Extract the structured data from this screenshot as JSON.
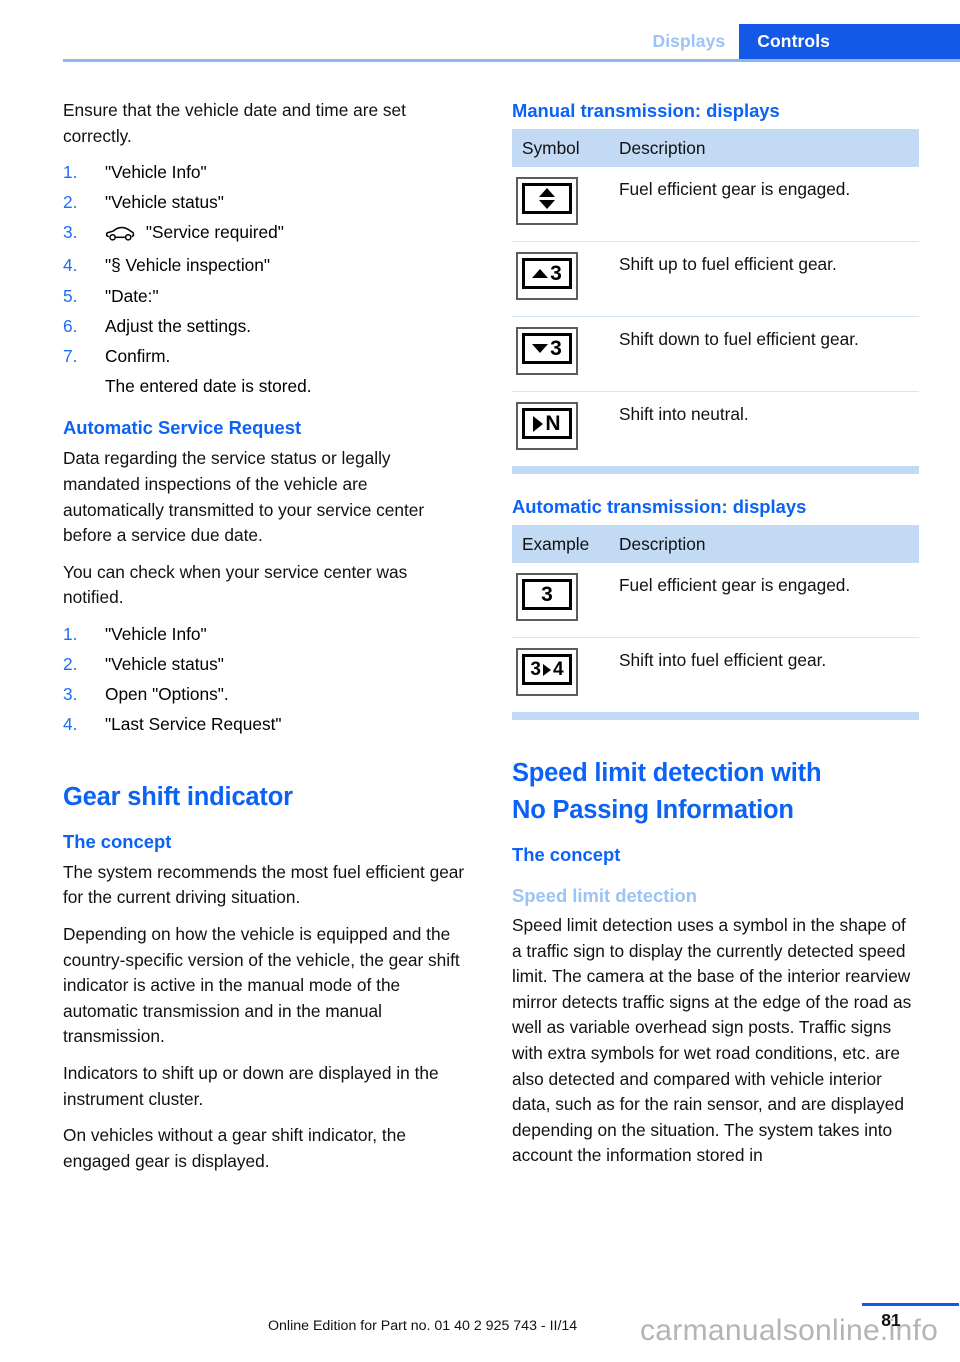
{
  "header": {
    "tab_inactive": "Displays",
    "tab_active": "Controls",
    "accent_blue": "#1458e8",
    "light_blue": "#9cc3f5"
  },
  "left_column": {
    "intro": "Ensure that the vehicle date and time are set correctly.",
    "steps_1": [
      {
        "num": "1.",
        "text": "\"Vehicle Info\""
      },
      {
        "num": "2.",
        "text": "\"Vehicle status\""
      },
      {
        "num": "3.",
        "text": "\"Service required\"",
        "icon": "car-icon"
      },
      {
        "num": "4.",
        "text": "\"§ Vehicle inspection\""
      },
      {
        "num": "5.",
        "text": "\"Date:\""
      },
      {
        "num": "6.",
        "text": "Adjust the settings."
      },
      {
        "num": "7.",
        "text": "Confirm."
      }
    ],
    "step_note": "The entered date is stored.",
    "asr_heading": "Automatic Service Request",
    "asr_p1": "Data regarding the service status or legally mandated inspections of the vehicle are automatically transmitted to your service center before a service due date.",
    "asr_p2": "You can check when your service center was notified.",
    "steps_2": [
      {
        "num": "1.",
        "text": "\"Vehicle Info\""
      },
      {
        "num": "2.",
        "text": "\"Vehicle status\""
      },
      {
        "num": "3.",
        "text": "Open \"Options\"."
      },
      {
        "num": "4.",
        "text": "\"Last Service Request\""
      }
    ],
    "gsi_title": "Gear shift indicator",
    "gsi_concept_heading": "The concept",
    "gsi_p1": "The system recommends the most fuel efficient gear for the current driving situation.",
    "gsi_p2": "Depending on how the vehicle is equipped and the country-specific version of the vehicle, the gear shift indicator is active in the manual mode of the automatic transmission and in the manual transmission.",
    "gsi_p3": "Indicators to shift up or down are displayed in the instrument cluster.",
    "gsi_p4": "On vehicles without a gear shift indicator, the engaged gear is displayed."
  },
  "right_column": {
    "manual_heading": "Manual transmission: displays",
    "manual_table": {
      "headers": [
        "Symbol",
        "Description"
      ],
      "rows": [
        {
          "symbol": "up-down-arrow-display-icon",
          "description": "Fuel efficient gear is engaged."
        },
        {
          "symbol": "shift-up-3-display-icon",
          "gear": "3",
          "description": "Shift up to fuel efficient gear."
        },
        {
          "symbol": "shift-down-3-display-icon",
          "gear": "3",
          "description": "Shift down to fuel efficient gear."
        },
        {
          "symbol": "shift-neutral-display-icon",
          "gear": "N",
          "description": "Shift into neutral."
        }
      ]
    },
    "automatic_heading": "Automatic transmission: displays",
    "automatic_table": {
      "headers": [
        "Example",
        "Description"
      ],
      "rows": [
        {
          "symbol": "gear-3-display-icon",
          "gear": "3",
          "description": "Fuel efficient gear is engaged."
        },
        {
          "symbol": "gear-3-to-4-display-icon",
          "gear_from": "3",
          "gear_to": "4",
          "description": "Shift into fuel efficient gear."
        }
      ]
    },
    "sld_title_line1": "Speed limit detection with",
    "sld_title_line2": "No Passing Information",
    "sld_concept_heading": "The concept",
    "sld_sub_heading": "Speed limit detection",
    "sld_p1": "Speed limit detection uses a symbol in the shape of a traffic sign to display the currently detected speed limit. The camera at the base of the interior rearview mirror detects traffic signs at the edge of the road as well as variable overhead sign posts. Traffic signs with extra symbols for wet road conditions, etc. are also detected and compared with vehicle interior data, such as for the rain sensor, and are displayed depending on the situation. The system takes into account the information stored in"
  },
  "footer": {
    "edition_text": "Online Edition for Part no. 01 40 2 925 743 - II/14",
    "page_number": "81",
    "watermark": "carmanualsonline.info"
  }
}
